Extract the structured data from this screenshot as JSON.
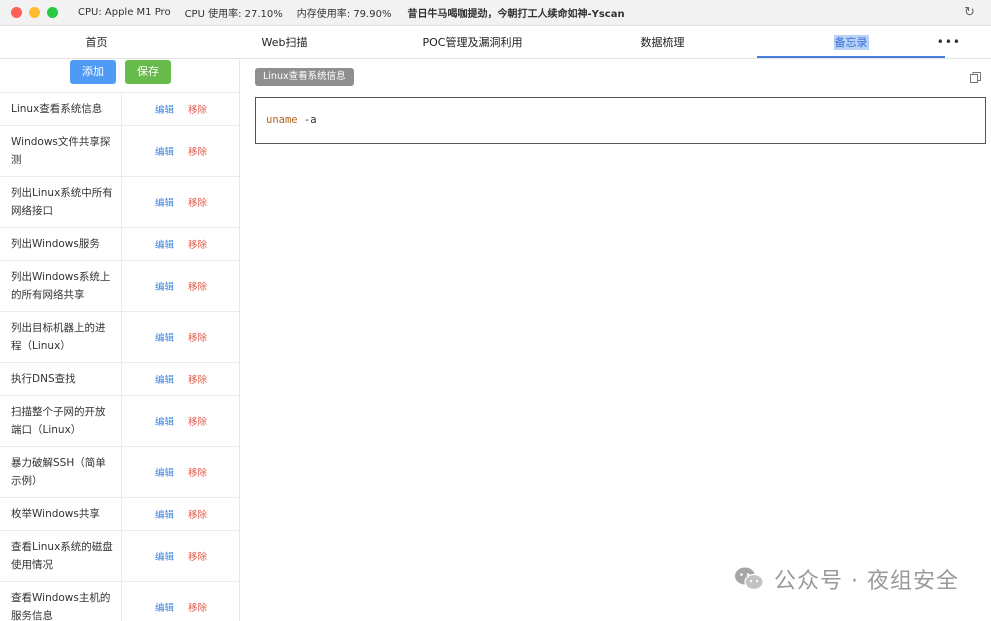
{
  "titlebar": {
    "cpu": "CPU: Apple M1 Pro",
    "cpu_usage": "CPU 使用率: 27.10%",
    "mem_usage": "内存使用率: 79.90%",
    "app_title": "昔日牛马喝咖提劲，今朝打工人续命如神-Yscan"
  },
  "tabs": [
    {
      "label": "首页"
    },
    {
      "label": "Web扫描"
    },
    {
      "label": "POC管理及漏洞利用"
    },
    {
      "label": "数据梳理"
    },
    {
      "label": "备忘录"
    }
  ],
  "more_label": "•••",
  "toolbar": {
    "add_label": "添加",
    "save_label": "保存"
  },
  "ops": {
    "edit": "编辑",
    "remove": "移除"
  },
  "notes": [
    {
      "title": "Linux查看系统信息"
    },
    {
      "title": "Windows文件共享探测"
    },
    {
      "title": "列出Linux系统中所有网络接口"
    },
    {
      "title": "列出Windows服务"
    },
    {
      "title": "列出Windows系统上的所有网络共享"
    },
    {
      "title": "列出目标机器上的进程（Linux）"
    },
    {
      "title": "执行DNS查找"
    },
    {
      "title": "扫描整个子网的开放端口（Linux）"
    },
    {
      "title": "暴力破解SSH（简单示例）"
    },
    {
      "title": "枚举Windows共享"
    },
    {
      "title": "查看Linux系统的磁盘使用情况"
    },
    {
      "title": "查看Windows主机的服务信息"
    }
  ],
  "detail": {
    "tag": "Linux查看系统信息",
    "code_cmd": "uname",
    "code_args": " -a"
  },
  "watermark": "公众号 · 夜组安全"
}
